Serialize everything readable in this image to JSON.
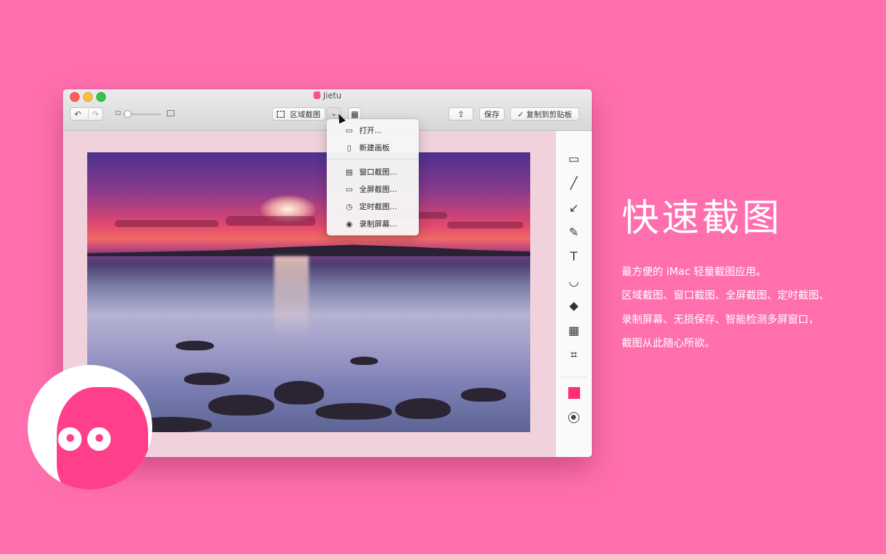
{
  "colors": {
    "background": "#ff6fae",
    "accent": "#ff2d7a",
    "logo": "#ff3f8c"
  },
  "window": {
    "title": "Jietu",
    "toolbar": {
      "undo_icon": "↶",
      "redo_icon": "↷",
      "capture_label": "区域截图",
      "dropdown_icon": "⌄",
      "qr_icon": "▦",
      "share_icon": "⇪",
      "save_label": "保存",
      "copy_label": "✓ 复制到剪贴板"
    }
  },
  "menu": {
    "items": [
      {
        "label": "打开...",
        "icon": "folder-icon"
      },
      {
        "label": "新建画板",
        "icon": "new-document-icon"
      },
      {
        "label": "窗口截图...",
        "icon": "window-icon"
      },
      {
        "label": "全屏截图...",
        "icon": "monitor-icon"
      },
      {
        "label": "定时截图...",
        "icon": "clock-icon"
      },
      {
        "label": "录制屏幕...",
        "icon": "record-icon"
      }
    ]
  },
  "tools": [
    {
      "name": "rectangle-tool-icon",
      "glyph": "▭"
    },
    {
      "name": "line-tool-icon",
      "glyph": "╱"
    },
    {
      "name": "arrow-tool-icon",
      "glyph": "↙"
    },
    {
      "name": "pencil-tool-icon",
      "glyph": "✎"
    },
    {
      "name": "text-tool-icon",
      "glyph": "T"
    },
    {
      "name": "emoji-tool-icon",
      "glyph": "◡"
    },
    {
      "name": "tag-tool-icon",
      "glyph": "◆"
    },
    {
      "name": "mosaic-tool-icon",
      "glyph": "▦"
    },
    {
      "name": "crop-tool-icon",
      "glyph": "⌗"
    }
  ],
  "marketing": {
    "headline": "快速截图",
    "lines": [
      "最方便的 iMac 轻量截图应用。",
      "区域截图、窗口截图、全屏截图、定时截图、",
      "录制屏幕、无损保存、智能检测多屏窗口，",
      "截图从此随心所欲。"
    ]
  }
}
